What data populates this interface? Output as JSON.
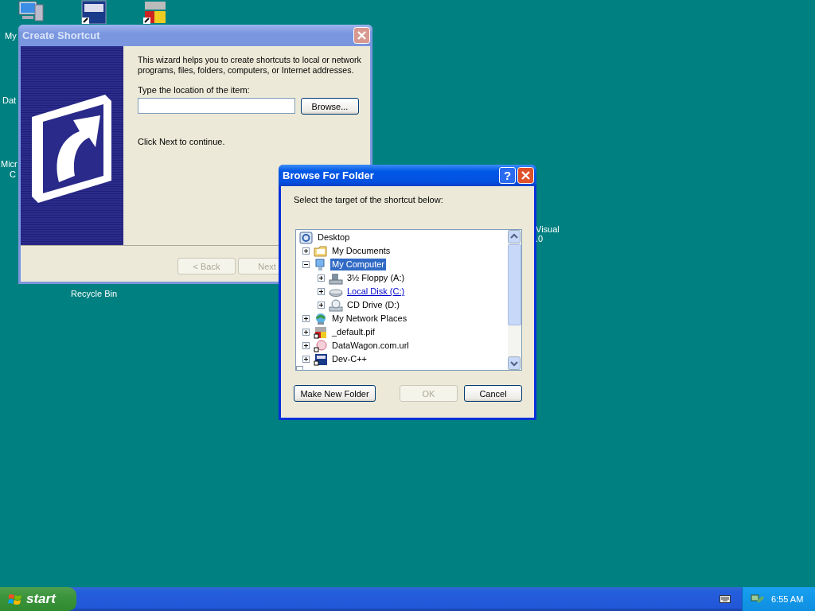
{
  "desktop_labels": [
    {
      "text": "My"
    },
    {
      "text": "Dat"
    },
    {
      "text": "Micr"
    },
    {
      "text": "C"
    },
    {
      "text": "Visual"
    },
    {
      "text": ".0"
    },
    {
      "text": "Recycle Bin"
    }
  ],
  "create_shortcut": {
    "title": "Create Shortcut",
    "active": false,
    "intro": "This wizard helps you to create shortcuts to local or network programs, files, folders, computers, or Internet addresses.",
    "location_label": "Type the location of the item:",
    "browse_button": "Browse...",
    "continue_text": "Click Next to continue.",
    "buttons": [
      {
        "label": "< Back",
        "disabled": true
      },
      {
        "label": "Next",
        "disabled": true
      }
    ]
  },
  "browse_for_folder": {
    "title": "Browse For Folder",
    "active": true,
    "help_button": "?",
    "prompt": "Select the target of the shortcut below:",
    "tree": [
      {
        "label": "Desktop",
        "kind": "desktop",
        "selected": false,
        "hot": false,
        "children": [
          {
            "label": "My Documents",
            "kind": "folder",
            "expanded": false,
            "selected": false,
            "hot": false
          },
          {
            "label": "My Computer",
            "kind": "computer",
            "expanded": true,
            "selected": true,
            "hot": false,
            "children": [
              {
                "label": "3½ Floppy (A:)",
                "kind": "floppy",
                "expanded": false,
                "selected": false,
                "hot": false
              },
              {
                "label": "Local Disk (C:)",
                "kind": "disk",
                "expanded": false,
                "selected": false,
                "hot": true
              },
              {
                "label": "CD Drive (D:)",
                "kind": "cd",
                "expanded": false,
                "selected": false,
                "hot": false
              }
            ]
          },
          {
            "label": "My Network Places",
            "kind": "network",
            "expanded": false,
            "selected": false,
            "hot": false
          },
          {
            "label": "_default.pif",
            "kind": "program",
            "expanded": false,
            "selected": false,
            "hot": false
          },
          {
            "label": "DataWagon.com.url",
            "kind": "web",
            "expanded": false,
            "selected": false,
            "hot": false
          },
          {
            "label": "Dev-C++",
            "kind": "app",
            "expanded": false,
            "selected": false,
            "hot": false
          }
        ]
      }
    ],
    "buttons": [
      {
        "label": "Make New Folder",
        "disabled": false
      },
      {
        "label": "OK",
        "disabled": true
      },
      {
        "label": "Cancel",
        "disabled": false
      }
    ]
  },
  "taskbar": {
    "start_label": "start",
    "clock": "6:55 AM"
  }
}
